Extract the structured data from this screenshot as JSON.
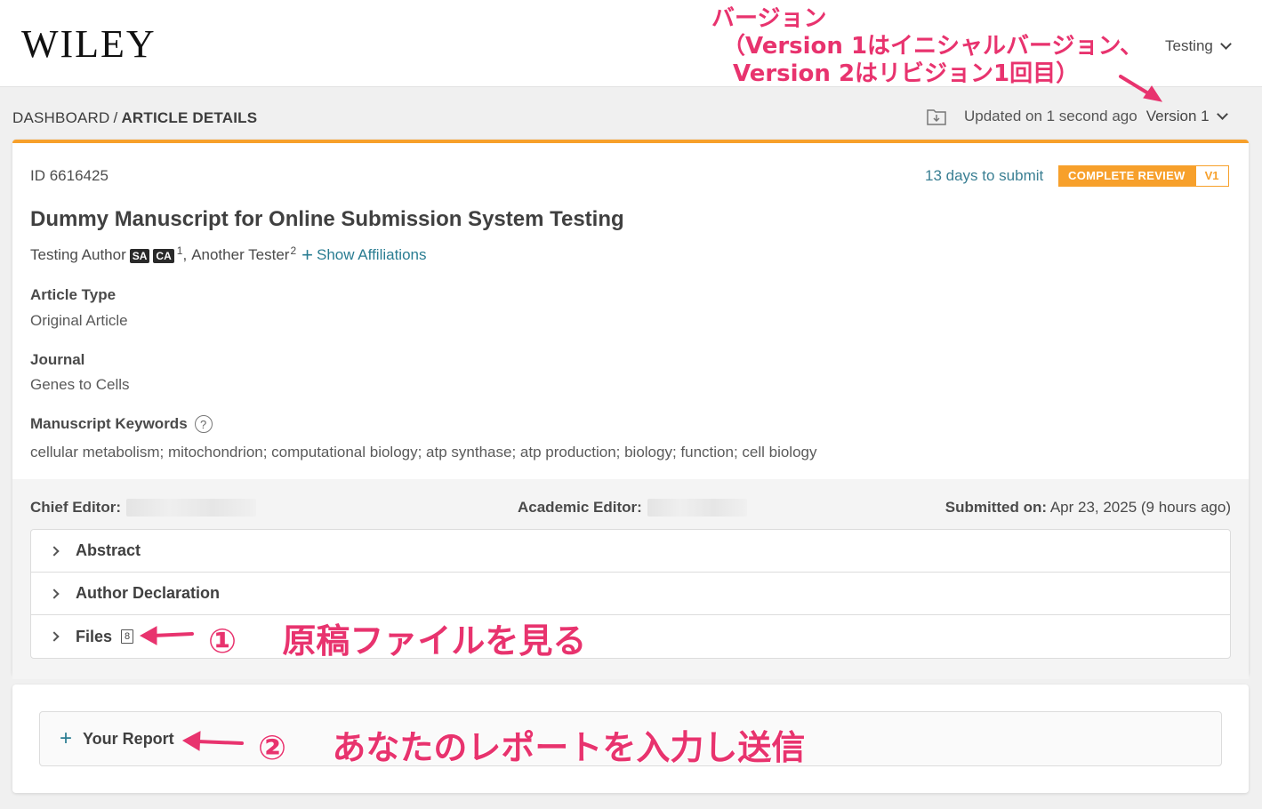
{
  "header": {
    "logo": "WILEY",
    "user_menu": "Testing"
  },
  "breadcrumb": {
    "root": "DASHBOARD",
    "separator": "/",
    "current": "ARTICLE DETAILS"
  },
  "meta": {
    "updated": "Updated on 1 second ago",
    "version": "Version 1"
  },
  "article": {
    "id": "ID 6616425",
    "days_to_submit": "13 days to submit",
    "status_label": "COMPLETE REVIEW",
    "status_version": "V1",
    "title": "Dummy Manuscript for Online Submission System Testing",
    "author1": "Testing Author",
    "author1_tag1": "SA",
    "author1_tag2": "CA",
    "author1_sup": "1",
    "author_sep": ",",
    "author2": "Another Tester",
    "author2_sup": "2",
    "show_affiliations": "Show Affiliations",
    "article_type_label": "Article Type",
    "article_type": "Original Article",
    "journal_label": "Journal",
    "journal": "Genes to Cells",
    "keywords_label": "Manuscript Keywords",
    "keywords": "cellular metabolism; mitochondrion; computational biology; atp synthase; atp production; biology; function; cell biology"
  },
  "editors": {
    "chief_label": "Chief Editor:",
    "academic_label": "Academic Editor:",
    "submitted_label": "Submitted on:",
    "submitted_value": "Apr 23, 2025 (9 hours ago)"
  },
  "accordion": {
    "abstract": "Abstract",
    "declaration": "Author Declaration",
    "files": "Files",
    "files_count": "8"
  },
  "report": {
    "label": "Your Report"
  },
  "annotations": {
    "version_line1": "バージョン",
    "version_line2": "（Version 1はイニシャルバージョン、",
    "version_line3": "Version 2はリビジョン1回目）",
    "files_num": "①",
    "files_text": "原稿ファイルを見る",
    "report_num": "②",
    "report_text": "あなたのレポートを入力し送信"
  },
  "colors": {
    "accent": "#f7a02b",
    "link": "#2a7d92",
    "annotation": "#e8336e"
  }
}
